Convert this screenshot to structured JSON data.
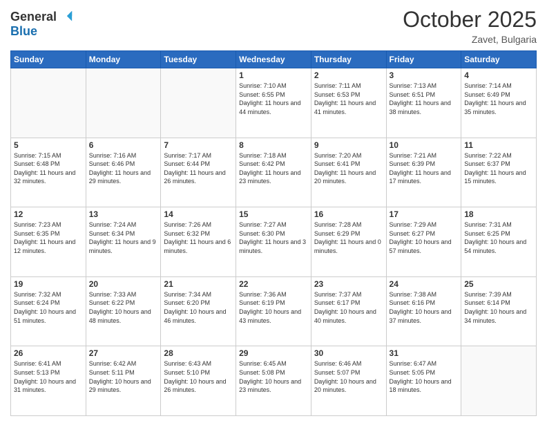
{
  "header": {
    "logo_general": "General",
    "logo_blue": "Blue",
    "month_title": "October 2025",
    "location": "Zavet, Bulgaria"
  },
  "weekdays": [
    "Sunday",
    "Monday",
    "Tuesday",
    "Wednesday",
    "Thursday",
    "Friday",
    "Saturday"
  ],
  "weeks": [
    [
      {
        "day": "",
        "info": ""
      },
      {
        "day": "",
        "info": ""
      },
      {
        "day": "",
        "info": ""
      },
      {
        "day": "1",
        "info": "Sunrise: 7:10 AM\nSunset: 6:55 PM\nDaylight: 11 hours and 44 minutes."
      },
      {
        "day": "2",
        "info": "Sunrise: 7:11 AM\nSunset: 6:53 PM\nDaylight: 11 hours and 41 minutes."
      },
      {
        "day": "3",
        "info": "Sunrise: 7:13 AM\nSunset: 6:51 PM\nDaylight: 11 hours and 38 minutes."
      },
      {
        "day": "4",
        "info": "Sunrise: 7:14 AM\nSunset: 6:49 PM\nDaylight: 11 hours and 35 minutes."
      }
    ],
    [
      {
        "day": "5",
        "info": "Sunrise: 7:15 AM\nSunset: 6:48 PM\nDaylight: 11 hours and 32 minutes."
      },
      {
        "day": "6",
        "info": "Sunrise: 7:16 AM\nSunset: 6:46 PM\nDaylight: 11 hours and 29 minutes."
      },
      {
        "day": "7",
        "info": "Sunrise: 7:17 AM\nSunset: 6:44 PM\nDaylight: 11 hours and 26 minutes."
      },
      {
        "day": "8",
        "info": "Sunrise: 7:18 AM\nSunset: 6:42 PM\nDaylight: 11 hours and 23 minutes."
      },
      {
        "day": "9",
        "info": "Sunrise: 7:20 AM\nSunset: 6:41 PM\nDaylight: 11 hours and 20 minutes."
      },
      {
        "day": "10",
        "info": "Sunrise: 7:21 AM\nSunset: 6:39 PM\nDaylight: 11 hours and 17 minutes."
      },
      {
        "day": "11",
        "info": "Sunrise: 7:22 AM\nSunset: 6:37 PM\nDaylight: 11 hours and 15 minutes."
      }
    ],
    [
      {
        "day": "12",
        "info": "Sunrise: 7:23 AM\nSunset: 6:35 PM\nDaylight: 11 hours and 12 minutes."
      },
      {
        "day": "13",
        "info": "Sunrise: 7:24 AM\nSunset: 6:34 PM\nDaylight: 11 hours and 9 minutes."
      },
      {
        "day": "14",
        "info": "Sunrise: 7:26 AM\nSunset: 6:32 PM\nDaylight: 11 hours and 6 minutes."
      },
      {
        "day": "15",
        "info": "Sunrise: 7:27 AM\nSunset: 6:30 PM\nDaylight: 11 hours and 3 minutes."
      },
      {
        "day": "16",
        "info": "Sunrise: 7:28 AM\nSunset: 6:29 PM\nDaylight: 11 hours and 0 minutes."
      },
      {
        "day": "17",
        "info": "Sunrise: 7:29 AM\nSunset: 6:27 PM\nDaylight: 10 hours and 57 minutes."
      },
      {
        "day": "18",
        "info": "Sunrise: 7:31 AM\nSunset: 6:25 PM\nDaylight: 10 hours and 54 minutes."
      }
    ],
    [
      {
        "day": "19",
        "info": "Sunrise: 7:32 AM\nSunset: 6:24 PM\nDaylight: 10 hours and 51 minutes."
      },
      {
        "day": "20",
        "info": "Sunrise: 7:33 AM\nSunset: 6:22 PM\nDaylight: 10 hours and 48 minutes."
      },
      {
        "day": "21",
        "info": "Sunrise: 7:34 AM\nSunset: 6:20 PM\nDaylight: 10 hours and 46 minutes."
      },
      {
        "day": "22",
        "info": "Sunrise: 7:36 AM\nSunset: 6:19 PM\nDaylight: 10 hours and 43 minutes."
      },
      {
        "day": "23",
        "info": "Sunrise: 7:37 AM\nSunset: 6:17 PM\nDaylight: 10 hours and 40 minutes."
      },
      {
        "day": "24",
        "info": "Sunrise: 7:38 AM\nSunset: 6:16 PM\nDaylight: 10 hours and 37 minutes."
      },
      {
        "day": "25",
        "info": "Sunrise: 7:39 AM\nSunset: 6:14 PM\nDaylight: 10 hours and 34 minutes."
      }
    ],
    [
      {
        "day": "26",
        "info": "Sunrise: 6:41 AM\nSunset: 5:13 PM\nDaylight: 10 hours and 31 minutes."
      },
      {
        "day": "27",
        "info": "Sunrise: 6:42 AM\nSunset: 5:11 PM\nDaylight: 10 hours and 29 minutes."
      },
      {
        "day": "28",
        "info": "Sunrise: 6:43 AM\nSunset: 5:10 PM\nDaylight: 10 hours and 26 minutes."
      },
      {
        "day": "29",
        "info": "Sunrise: 6:45 AM\nSunset: 5:08 PM\nDaylight: 10 hours and 23 minutes."
      },
      {
        "day": "30",
        "info": "Sunrise: 6:46 AM\nSunset: 5:07 PM\nDaylight: 10 hours and 20 minutes."
      },
      {
        "day": "31",
        "info": "Sunrise: 6:47 AM\nSunset: 5:05 PM\nDaylight: 10 hours and 18 minutes."
      },
      {
        "day": "",
        "info": ""
      }
    ]
  ]
}
